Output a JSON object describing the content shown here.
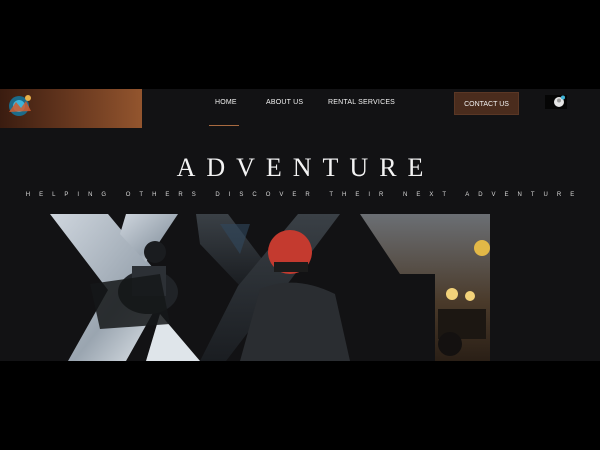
{
  "nav": {
    "items": [
      {
        "label": "HOME"
      },
      {
        "label": "ABOUT US"
      },
      {
        "label": "RENTAL SERVICES"
      }
    ],
    "contact_label": "CONTACT US"
  },
  "hero": {
    "title": "ADVENTURE",
    "subtitle": "HELPING OTHERS DISCOVER THEIR NEXT ADVENTURE"
  },
  "colors": {
    "page_bg": "#121214",
    "accent": "#4a2c1d",
    "logo_gradient_end": "#93552e"
  },
  "icons": [
    "logo-icon",
    "profile-icon"
  ]
}
